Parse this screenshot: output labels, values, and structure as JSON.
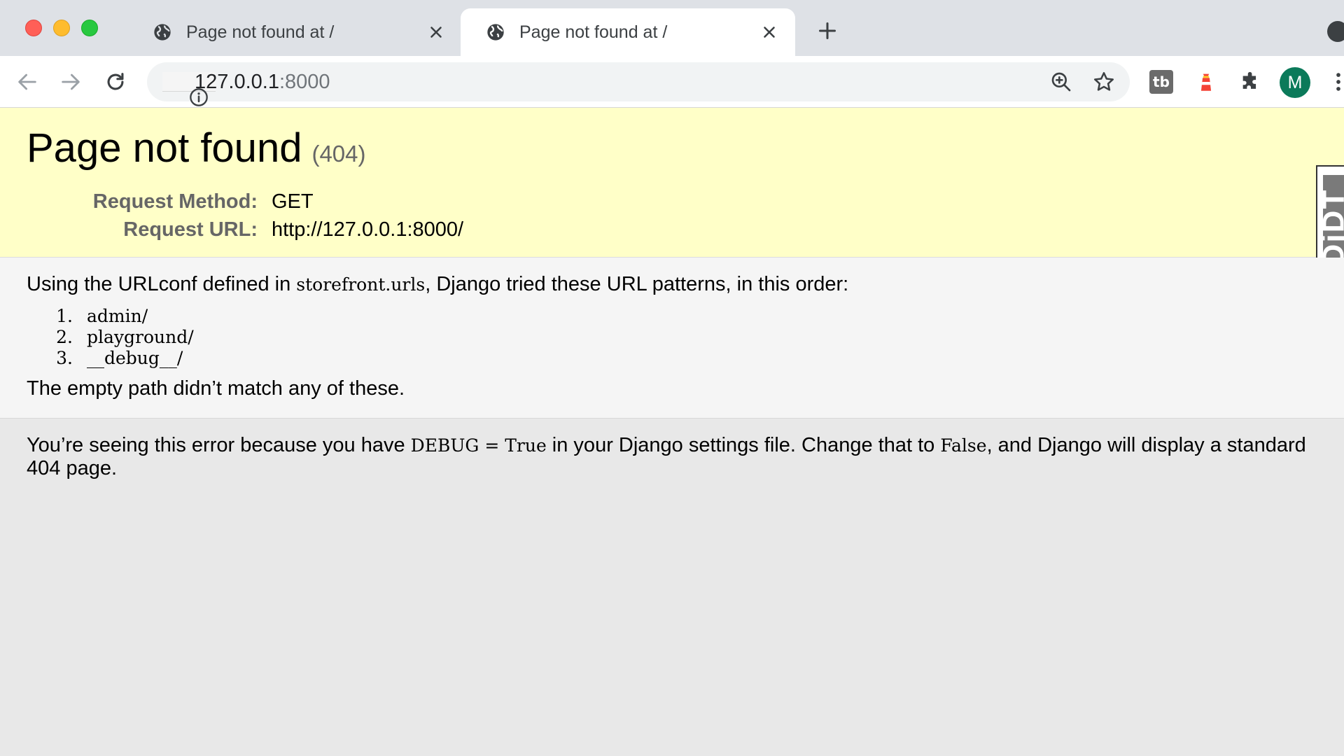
{
  "browser": {
    "tabs": [
      {
        "title": "Page not found at /",
        "active": false
      },
      {
        "title": "Page not found at /",
        "active": true
      }
    ],
    "address_bar": {
      "host": "127.0.0.1",
      "port": ":8000"
    },
    "profile_initial": "M",
    "extension_label": "tb",
    "colors": {
      "accent": "#0b7a5a",
      "tabstrip": "#dee1e6"
    }
  },
  "summary": {
    "title": "Page not found",
    "status": "(404)",
    "request_method_label": "Request Method:",
    "request_method_value": "GET",
    "request_url_label": "Request URL:",
    "request_url_value": "http://127.0.0.1:8000/",
    "background": "#ffffc8"
  },
  "debug_toolbar_handle": {
    "label": "DjDT"
  },
  "info": {
    "intro_prefix": "Using the URLconf defined in ",
    "urlconf": "storefront.urls",
    "intro_suffix": ", Django tried these URL patterns, in this order:",
    "patterns": [
      {
        "num": "1.",
        "pattern": "admin/"
      },
      {
        "num": "2.",
        "pattern": "playground/"
      },
      {
        "num": "3.",
        "pattern": "__debug__/"
      }
    ],
    "no_match": "The empty path didn’t match any of these."
  },
  "explanation": {
    "part1": "You’re seeing this error because you have ",
    "code1": "DEBUG = True",
    "part2": " in your Django settings file. Change that to ",
    "code2": "False",
    "part3": ", and Django will display a standard 404 page."
  }
}
